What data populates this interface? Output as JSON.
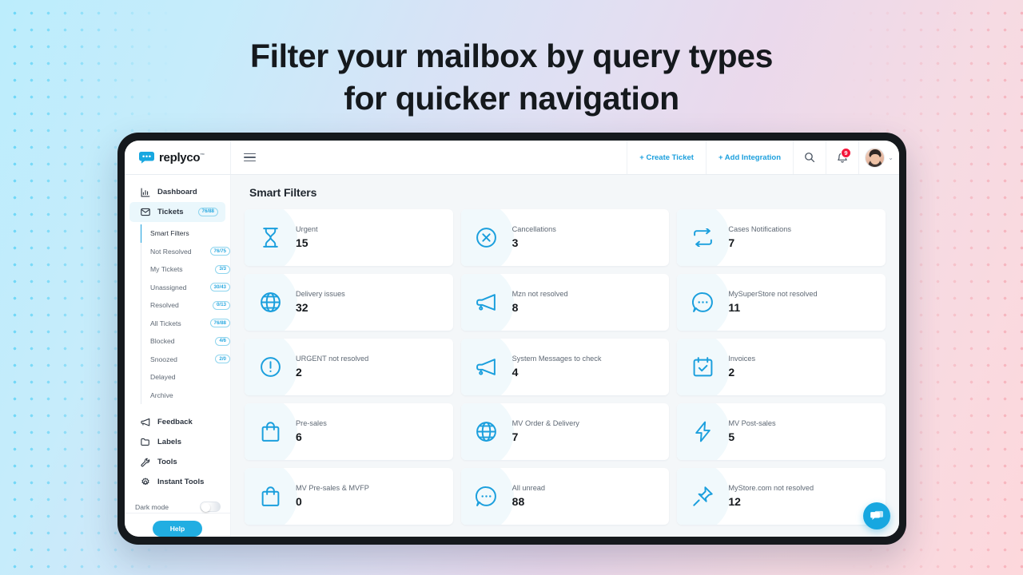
{
  "headline": {
    "line1": "Filter your mailbox by query types",
    "line2": "for quicker navigation"
  },
  "colors": {
    "accent": "#1b9fdd",
    "accent_dark": "#17a7e0",
    "badge_red": "#f5173b",
    "bg_left": "#bcedfc",
    "bg_right": "#fdd8dc",
    "card_blob": "#f1f9fc",
    "main_bg": "#f4f7f9"
  },
  "topbar": {
    "brand_name": "replyco",
    "brand_tm": "™",
    "menu_icon": "hamburger-icon",
    "create_ticket_label": "+ Create Ticket",
    "add_integration_label": "+ Add Integration",
    "search_icon": "search-icon",
    "notifications_icon": "bell-icon",
    "notifications_count": "9",
    "user_caret": "⌄"
  },
  "sidebar": {
    "items": [
      {
        "label": "Dashboard",
        "icon": "chart-bar-icon",
        "badge": "",
        "active": false
      },
      {
        "label": "Tickets",
        "icon": "envelope-icon",
        "badge": "76/88",
        "active": true
      }
    ],
    "subitems": [
      {
        "label": "Smart Filters",
        "badge": "",
        "active": true
      },
      {
        "label": "Not Resolved",
        "badge": "76/75",
        "active": false
      },
      {
        "label": "My Tickets",
        "badge": "3/3",
        "active": false
      },
      {
        "label": "Unassigned",
        "badge": "30/43",
        "active": false
      },
      {
        "label": "Resolved",
        "badge": "0/13",
        "active": false
      },
      {
        "label": "All Tickets",
        "badge": "76/88",
        "active": false
      },
      {
        "label": "Blocked",
        "badge": "4/6",
        "active": false
      },
      {
        "label": "Snoozed",
        "badge": "2/0",
        "active": false
      },
      {
        "label": "Delayed",
        "badge": "",
        "active": false
      },
      {
        "label": "Archive",
        "badge": "",
        "active": false
      }
    ],
    "bottom_items": [
      {
        "label": "Feedback",
        "icon": "megaphone-icon"
      },
      {
        "label": "Labels",
        "icon": "folder-icon"
      },
      {
        "label": "Tools",
        "icon": "wrench-icon"
      },
      {
        "label": "Instant Tools",
        "icon": "gear-icon"
      }
    ],
    "dark_mode_label": "Dark mode",
    "dark_mode_on": false,
    "help_label": "Help"
  },
  "main": {
    "page_title": "Smart Filters",
    "cards": [
      {
        "label": "Urgent",
        "value": "15",
        "icon": "hourglass-icon"
      },
      {
        "label": "Cancellations",
        "value": "3",
        "icon": "circle-x-icon"
      },
      {
        "label": "Cases Notifications",
        "value": "7",
        "icon": "repeat-icon"
      },
      {
        "label": "Delivery issues",
        "value": "32",
        "icon": "globe-icon"
      },
      {
        "label": "Mzn not resolved",
        "value": "8",
        "icon": "megaphone-icon"
      },
      {
        "label": "MySuperStore not resolved",
        "value": "11",
        "icon": "chat-dots-icon"
      },
      {
        "label": "URGENT not resolved",
        "value": "2",
        "icon": "alert-circle-icon"
      },
      {
        "label": "System Messages to check",
        "value": "4",
        "icon": "megaphone-icon"
      },
      {
        "label": "Invoices",
        "value": "2",
        "icon": "calendar-check-icon"
      },
      {
        "label": "Pre-sales",
        "value": "6",
        "icon": "shopping-bag-icon"
      },
      {
        "label": "MV Order & Delivery",
        "value": "7",
        "icon": "globe-icon"
      },
      {
        "label": "MV Post-sales",
        "value": "5",
        "icon": "lightning-icon"
      },
      {
        "label": "MV Pre-sales & MVFP",
        "value": "0",
        "icon": "shopping-bag-icon"
      },
      {
        "label": "All unread",
        "value": "88",
        "icon": "chat-dots-icon"
      },
      {
        "label": "MyStore.com not resolved",
        "value": "12",
        "icon": "pin-icon"
      }
    ]
  },
  "chat_widget": {
    "icon": "chat-bubbles-icon"
  }
}
